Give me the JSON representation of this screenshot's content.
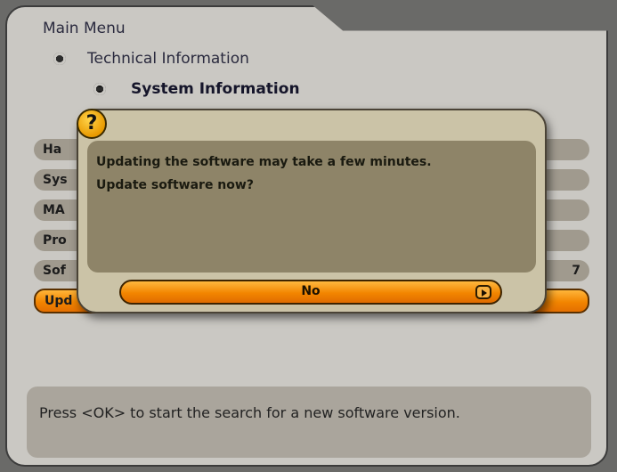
{
  "breadcrumb": {
    "main_menu": "Main Menu",
    "technical_information": "Technical Information",
    "system_information": "System Information"
  },
  "rows": [
    {
      "label": "Ha",
      "value": ""
    },
    {
      "label": "Sys",
      "value": ""
    },
    {
      "label": "MA",
      "value": ""
    },
    {
      "label": "Pro",
      "value": ""
    },
    {
      "label": "Sof",
      "value": "7"
    },
    {
      "label": "Upd",
      "value": ""
    }
  ],
  "help_text": "Press <OK> to start the search for a new software version.",
  "dialog": {
    "icon": "question-icon",
    "icon_symbol": "?",
    "message_line1": "Updating the software may take a few minutes.",
    "message_line2": "Update software now?",
    "selected_option": "No",
    "ok_icon": "ok-play-icon"
  },
  "colors": {
    "accent_orange": "#f28500",
    "panel_bg": "#cac8c3",
    "dialog_bg": "#cbc3a7"
  }
}
